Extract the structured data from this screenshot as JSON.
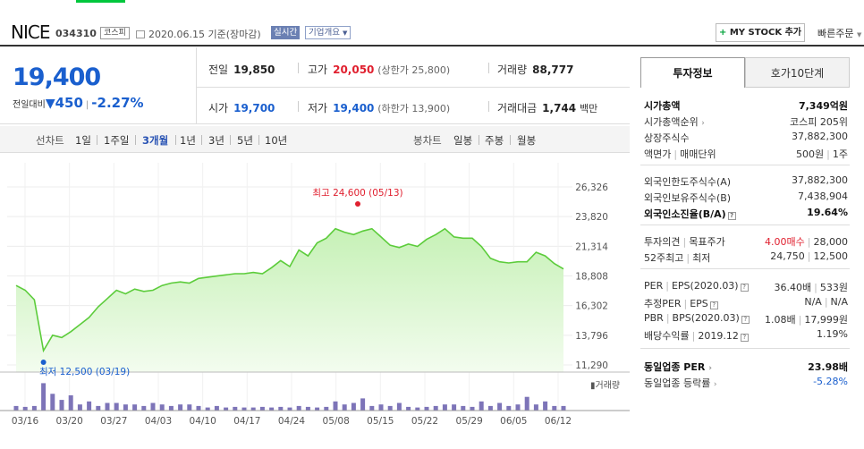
{
  "header": {
    "stock_name": "NICE",
    "stock_code": "034310",
    "market_badge": "코스피",
    "date_text": "2020.06.15 기준(장마감)",
    "realtime_label": "실시간",
    "company_overview_label": "기업개요",
    "my_stock_button": "MY STOCK 추가",
    "quick_order_label": "빠른주문"
  },
  "price": {
    "current": "19,400",
    "change_label": "전일대비",
    "change_amount": "450",
    "change_pct": "-2.27%",
    "prev_close_label": "전일",
    "prev_close": "19,850",
    "high_label": "고가",
    "high": "20,050",
    "upper_limit_text": "(상한가 25,800)",
    "volume_label": "거래량",
    "volume": "88,777",
    "open_label": "시가",
    "open": "19,700",
    "low_label": "저가",
    "low": "19,400",
    "lower_limit_text": "(하한가 13,900)",
    "trade_value_label": "거래대금",
    "trade_value": "1,744",
    "trade_value_unit": "백만"
  },
  "periods": {
    "line_label": "선차트",
    "line_items": [
      "1일",
      "1주일",
      "3개월",
      "1년",
      "3년",
      "5년",
      "10년"
    ],
    "active": "3개월",
    "candle_label": "봉차트",
    "candle_items": [
      "일봉",
      "주봉",
      "월봉"
    ]
  },
  "chart_data": {
    "type": "area",
    "y_ticks": [
      "26,326",
      "23,820",
      "21,314",
      "18,808",
      "16,302",
      "13,796",
      "11,290"
    ],
    "ylim": [
      11290,
      26326
    ],
    "x_ticks": [
      "03/16",
      "03/20",
      "03/27",
      "04/03",
      "04/10",
      "04/17",
      "04/24",
      "05/08",
      "05/15",
      "05/22",
      "05/29",
      "06/05",
      "06/12"
    ],
    "high_annotation": "최고 24,600 (05/13)",
    "low_annotation": "최저 12,500 (03/19)",
    "volume_label": "거래량",
    "values": [
      18000,
      17600,
      16800,
      12500,
      13800,
      13600,
      14100,
      14700,
      15300,
      16200,
      16900,
      17600,
      17300,
      17700,
      17500,
      17600,
      18000,
      18200,
      18300,
      18200,
      18600,
      18700,
      18800,
      18900,
      19000,
      19000,
      19100,
      19000,
      19500,
      20100,
      19600,
      21000,
      20500,
      21600,
      22000,
      22800,
      22500,
      22300,
      22600,
      22800,
      22100,
      21400,
      21200,
      21500,
      21300,
      21900,
      22300,
      22800,
      22100,
      22000,
      22000,
      21300,
      20300,
      20000,
      19900,
      20000,
      20000,
      20800,
      20500,
      19850,
      19400
    ],
    "volumes": [
      0.15,
      0.12,
      0.15,
      0.9,
      0.55,
      0.35,
      0.5,
      0.2,
      0.3,
      0.15,
      0.25,
      0.25,
      0.2,
      0.2,
      0.15,
      0.25,
      0.2,
      0.15,
      0.2,
      0.2,
      0.15,
      0.1,
      0.15,
      0.1,
      0.12,
      0.1,
      0.1,
      0.12,
      0.1,
      0.12,
      0.1,
      0.15,
      0.12,
      0.1,
      0.12,
      0.3,
      0.2,
      0.25,
      0.4,
      0.15,
      0.2,
      0.15,
      0.25,
      0.12,
      0.1,
      0.12,
      0.15,
      0.2,
      0.2,
      0.15,
      0.12,
      0.3,
      0.15,
      0.25,
      0.15,
      0.2,
      0.45,
      0.2,
      0.3,
      0.15,
      0.15
    ]
  },
  "info_panel": {
    "tab_active": "투자정보",
    "tab_other": "호가10단계",
    "market_cap_label": "시가총액",
    "market_cap": "7,349억원",
    "cap_rank_label": "시가총액순위",
    "cap_rank": "코스피 205위",
    "shares_label": "상장주식수",
    "shares": "37,882,300",
    "par_label": "액면가",
    "unit_label": "매매단위",
    "par_value": "500원",
    "unit_value": "1주",
    "foreign_limit_label": "외국인한도주식수(A)",
    "foreign_limit": "37,882,300",
    "foreign_hold_label": "외국인보유주식수(B)",
    "foreign_hold": "7,438,904",
    "foreign_ratio_label": "외국인소진율(B/A)",
    "foreign_ratio": "19.64%",
    "opinion_label": "투자의견",
    "target_label": "목표주가",
    "opinion_value": "4.00매수",
    "target_value": "28,000",
    "w52_high_label": "52주최고",
    "w52_low_label": "최저",
    "w52_high": "24,750",
    "w52_low": "12,500",
    "per_label": "PER",
    "eps_label": "EPS",
    "eps_period": "(2020.03)",
    "per_value": "36.40배",
    "eps_value": "533원",
    "est_per_label": "추정PER",
    "est_eps_label": "EPS",
    "est_per_value": "N/A",
    "est_eps_value": "N/A",
    "pbr_label": "PBR",
    "bps_label": "BPS",
    "bps_period": "(2020.03)",
    "pbr_value": "1.08배",
    "bps_value": "17,999원",
    "div_label": "배당수익률",
    "div_period": "2019.12",
    "div_value": "1.19%",
    "sector_per_label": "동일업종 PER",
    "sector_per": "23.98배",
    "sector_chg_label": "동일업종 등락률",
    "sector_chg": "-5.28%"
  }
}
